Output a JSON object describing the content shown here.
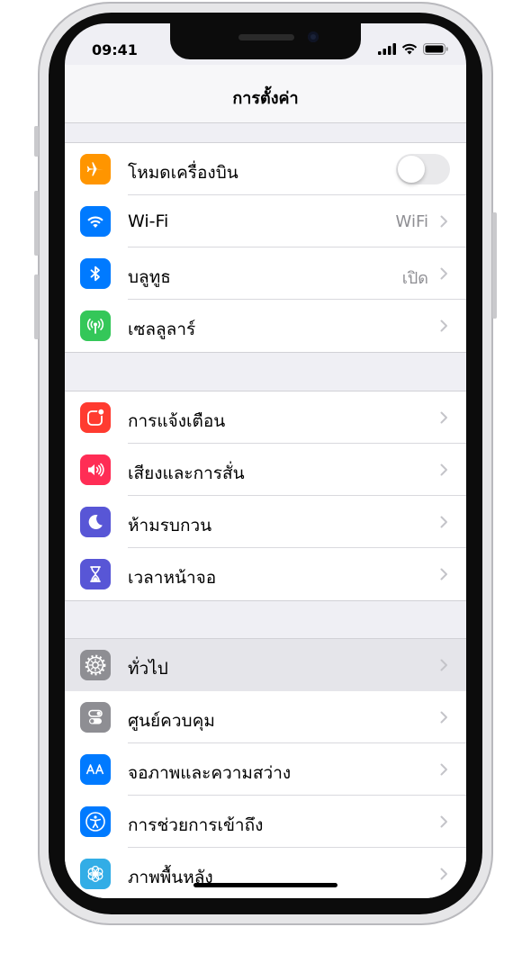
{
  "status_bar": {
    "time": "09:41"
  },
  "nav": {
    "title": "การตั้งค่า"
  },
  "colors": {
    "orange": "#ff9500",
    "blue": "#007aff",
    "green": "#34c759",
    "red": "#ff3b30",
    "pink": "#ff2d55",
    "purple": "#5856d6",
    "gray": "#8e8e93",
    "cyan": "#32ade6"
  },
  "groups": [
    {
      "rows": [
        {
          "label": "โหมดเครื่องบิน",
          "icon": "airplane-icon",
          "control": "toggle",
          "toggle_on": false
        },
        {
          "label": "Wi-Fi",
          "icon": "wifi-icon",
          "value": "WiFi"
        },
        {
          "label": "บลูทูธ",
          "icon": "bluetooth-icon",
          "value": "เปิด"
        },
        {
          "label": "เซลลูลาร์",
          "icon": "cellular-icon"
        }
      ]
    },
    {
      "rows": [
        {
          "label": "การแจ้งเตือน",
          "icon": "notifications-icon"
        },
        {
          "label": "เสียงและการสั่น",
          "icon": "speaker-icon"
        },
        {
          "label": "ห้ามรบกวน",
          "icon": "moon-icon"
        },
        {
          "label": "เวลาหน้าจอ",
          "icon": "hourglass-icon"
        }
      ]
    },
    {
      "rows": [
        {
          "label": "ทั่วไป",
          "icon": "gear-icon",
          "highlighted": true
        },
        {
          "label": "ศูนย์ควบคุม",
          "icon": "control-center-icon"
        },
        {
          "label": "จอภาพและความสว่าง",
          "icon": "display-brightness-icon"
        },
        {
          "label": "การช่วยการเข้าถึง",
          "icon": "accessibility-icon"
        },
        {
          "label": "ภาพพื้นหลัง",
          "icon": "wallpaper-icon"
        }
      ]
    }
  ]
}
